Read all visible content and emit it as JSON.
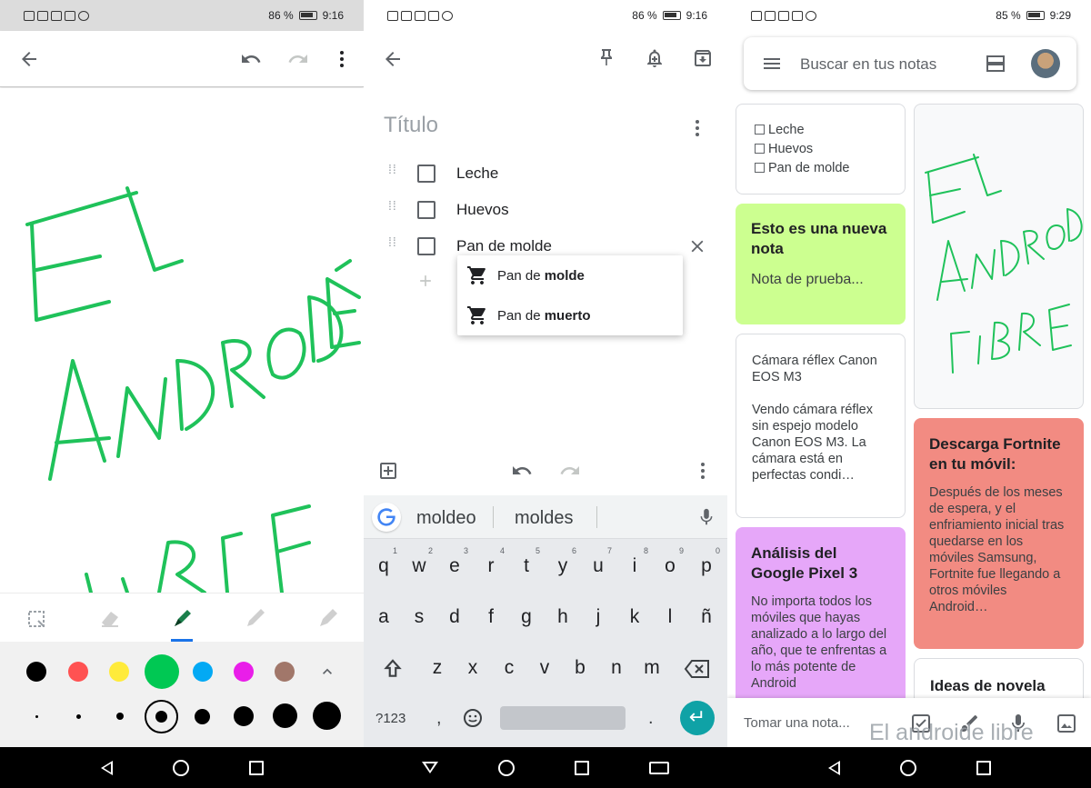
{
  "status": [
    {
      "battery": "86 %",
      "time": "9:16"
    },
    {
      "battery": "86 %",
      "time": "9:16"
    },
    {
      "battery": "85 %",
      "time": "9:29"
    }
  ],
  "drawing": {
    "handwriting": "EL ANDROIDE LIBRE",
    "ink_color": "#1fc25a",
    "tools": [
      "select-icon",
      "eraser-icon",
      "marker-icon",
      "pen-icon",
      "highlighter-icon"
    ],
    "palette": [
      "#000000",
      "#ff5252",
      "#ffeb3b",
      "#00c853",
      "#03a9f4",
      "#e91ee9",
      "#a1776a"
    ],
    "selected_color": "#00c853"
  },
  "note": {
    "title_placeholder": "Título",
    "items": [
      "Leche",
      "Huevos",
      "Pan de molde"
    ],
    "suggestions": [
      {
        "prefix": "Pan de ",
        "bold": "molde"
      },
      {
        "prefix": "Pan de ",
        "bold": "muerto"
      }
    ]
  },
  "keyboard": {
    "suggestions": [
      "moldeo",
      "moldes"
    ],
    "row1": [
      "q",
      "w",
      "e",
      "r",
      "t",
      "y",
      "u",
      "i",
      "o",
      "p"
    ],
    "row1_hints": [
      "1",
      "2",
      "3",
      "4",
      "5",
      "6",
      "7",
      "8",
      "9",
      "0"
    ],
    "row2": [
      "a",
      "s",
      "d",
      "f",
      "g",
      "h",
      "j",
      "k",
      "l",
      "ñ"
    ],
    "row3": [
      "z",
      "x",
      "c",
      "v",
      "b",
      "n",
      "m"
    ],
    "symbols_key": "?123",
    "comma": ",",
    "period": "."
  },
  "keep": {
    "search_placeholder": "Buscar en tus notas",
    "list_card": [
      "Leche",
      "Huevos",
      "Pan de molde"
    ],
    "cards": {
      "green": {
        "title": "Esto es una nueva nota",
        "body": "Nota de prueba...",
        "color": "#ccff90"
      },
      "camera": {
        "title": "Cámara réflex Canon EOS M3",
        "body": "Vendo cámara réflex sin espejo modelo Canon EOS M3. La cámara está en perfectas condi…"
      },
      "purple": {
        "title": "Análisis del Google Pixel 3",
        "body": "No importa todos los móviles que hayas analizado a lo largo del año, que te enfrentas a lo más potente de Android",
        "color": "#e6a7f9"
      },
      "red": {
        "title": "Descarga Fortnite en tu móvil:",
        "body": "Después de los meses de espera, y el enfriamiento inicial tras quedarse en los móviles Samsung, Fortnite fue llegando a otros móviles Android…",
        "color": "#f28b82"
      },
      "ideas": {
        "title": "Ideas de novela"
      }
    },
    "take_note": "Tomar una nota...",
    "watermark": "El androide libre"
  }
}
